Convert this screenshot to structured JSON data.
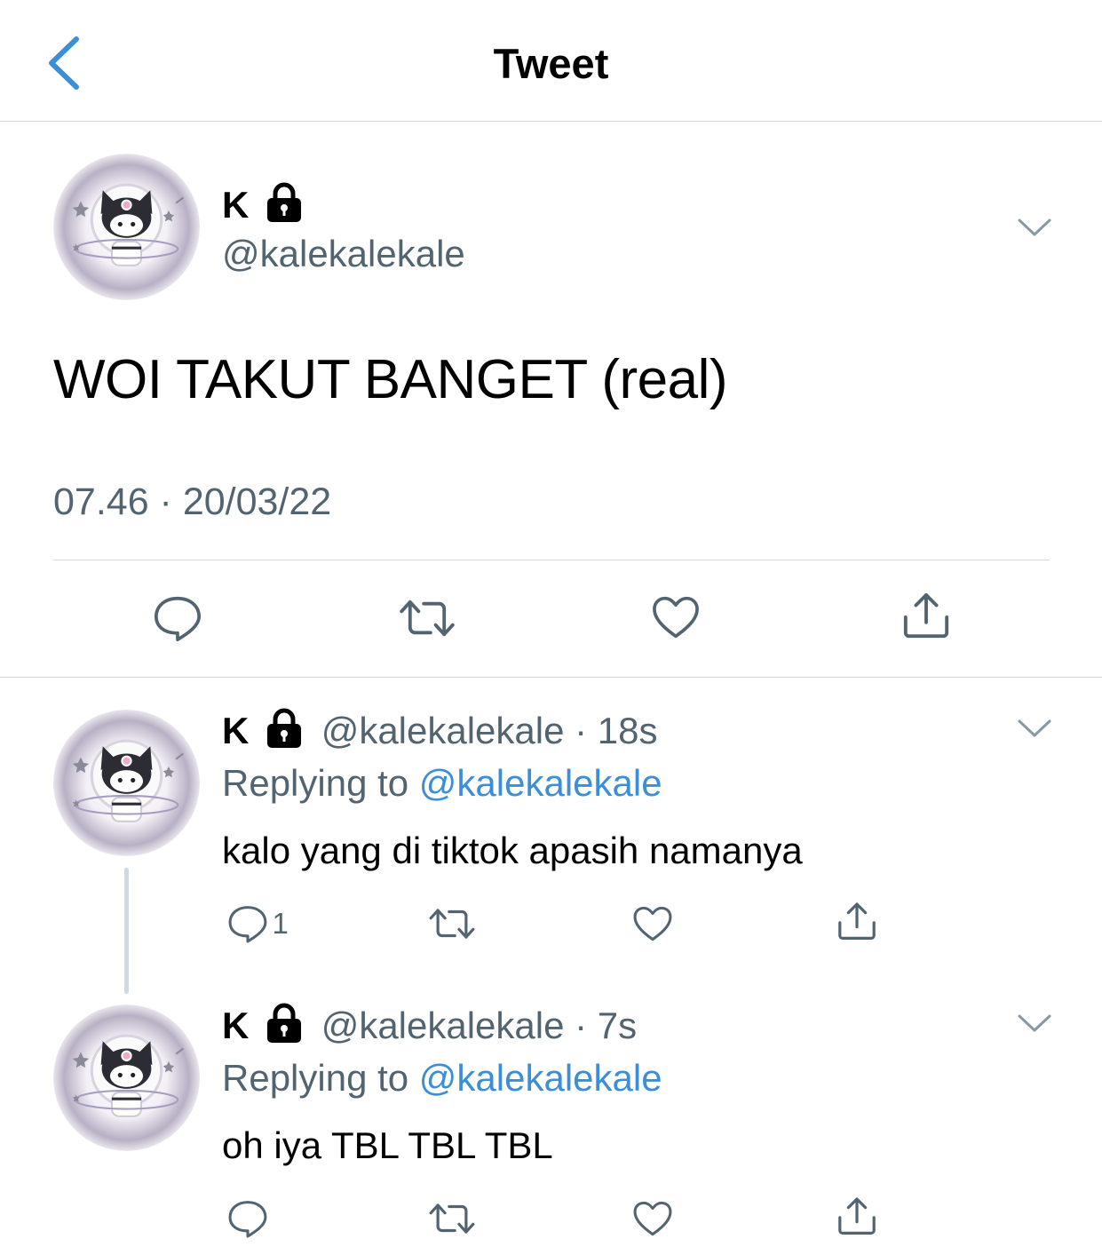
{
  "header": {
    "title": "Tweet"
  },
  "main_tweet": {
    "author_name": "K",
    "handle": "@kalekalekale",
    "text": "WOI TAKUT BANGET (real)",
    "timestamp": "07.46 · 20/03/22"
  },
  "replies": [
    {
      "author_name": "K",
      "handle": "@kalekalekale",
      "time": "· 18s",
      "replying_prefix": "Replying to",
      "replying_to": "@kalekalekale",
      "text": "kalo yang di tiktok apasih namanya",
      "reply_count": "1"
    },
    {
      "author_name": "K",
      "handle": "@kalekalekale",
      "time": "· 7s",
      "replying_prefix": "Replying to",
      "replying_to": "@kalekalekale",
      "text": "oh iya TBL TBL TBL",
      "reply_count": ""
    }
  ],
  "icons": {
    "back": "chevron-left-icon",
    "lock": "lock-icon",
    "more": "chevron-down-icon",
    "reply": "reply-icon",
    "retweet": "retweet-icon",
    "like": "heart-icon",
    "share": "share-icon"
  },
  "colors": {
    "accent": "#3b8ed8",
    "secondary_text": "#536471",
    "divider": "#cfd9de"
  }
}
